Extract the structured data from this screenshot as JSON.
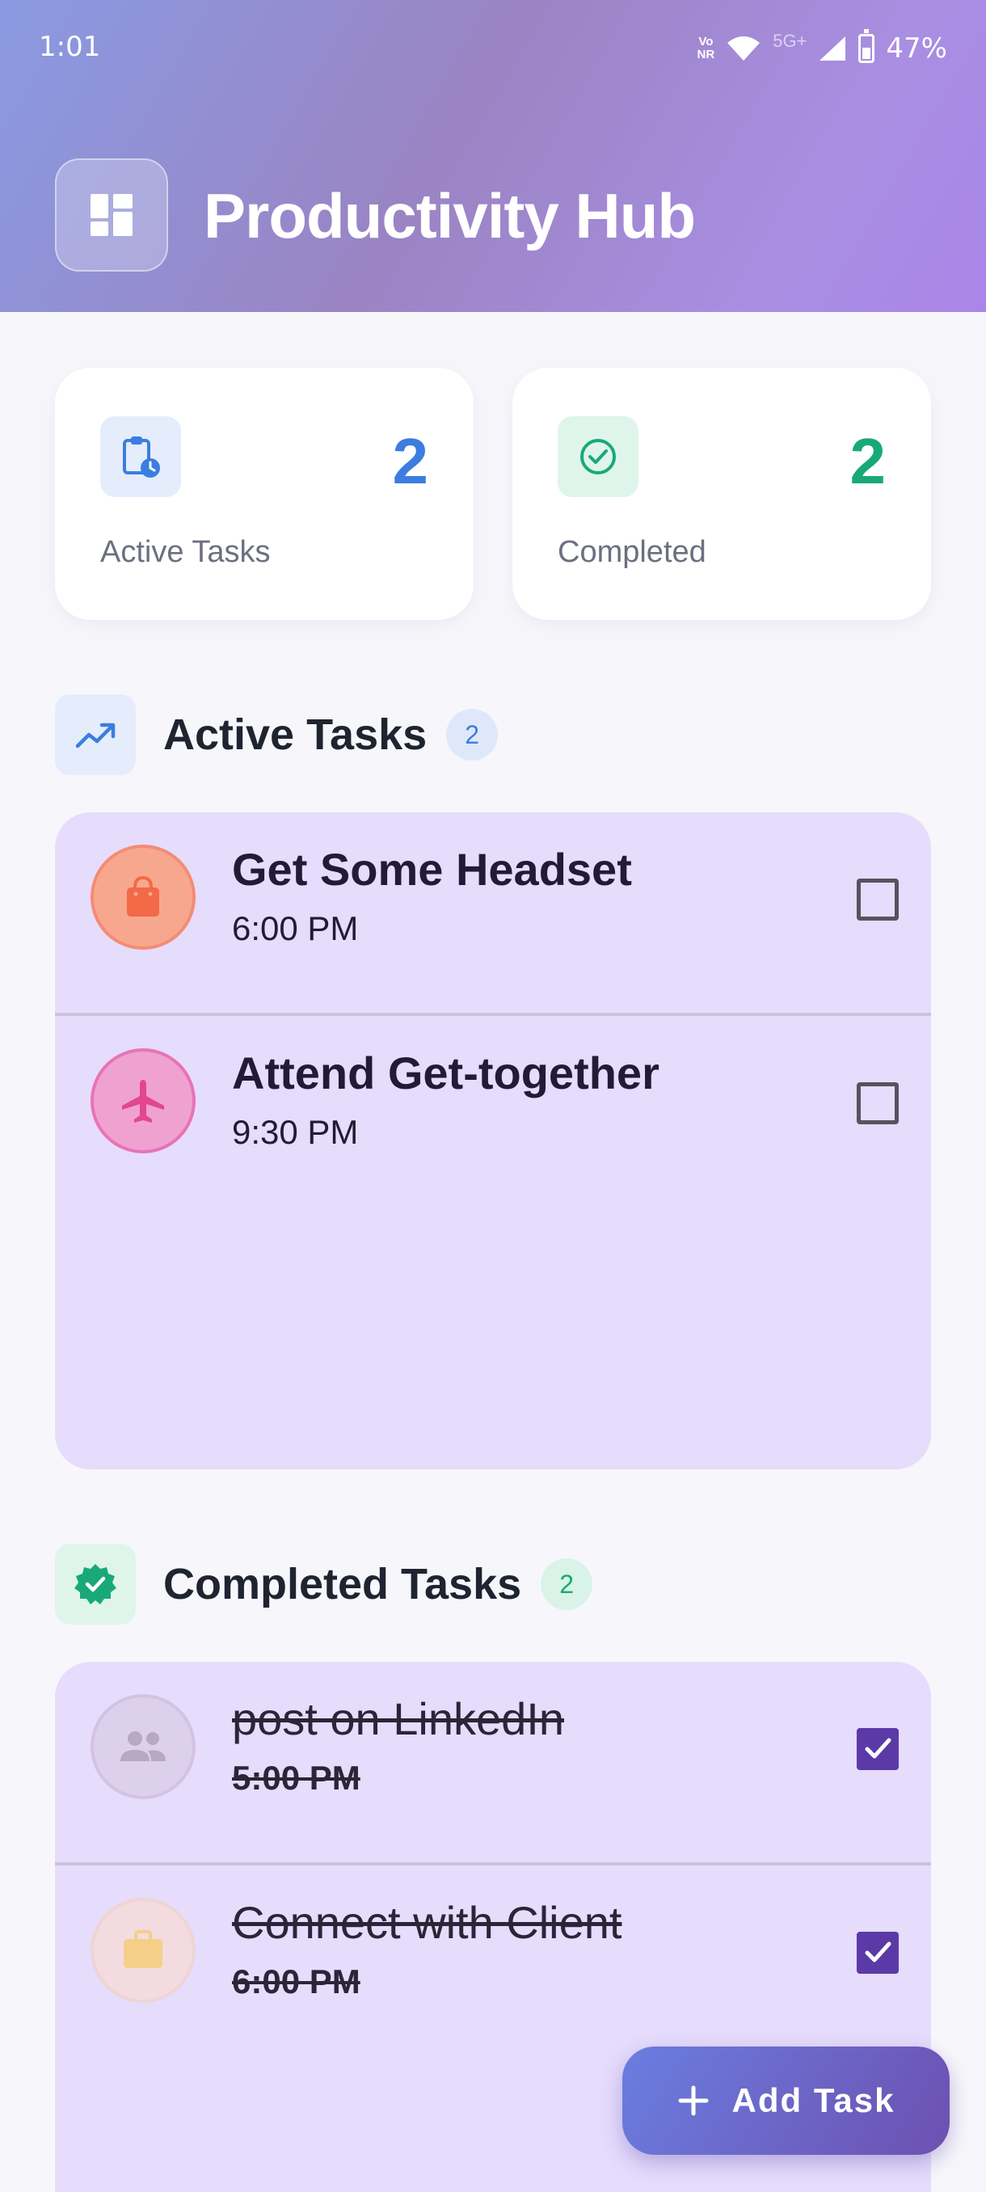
{
  "status_bar": {
    "time": "1:01",
    "volte": "Vo\nNR",
    "network": "5G+",
    "battery": "47%"
  },
  "header": {
    "title": "Productivity Hub"
  },
  "stats": [
    {
      "value": "2",
      "label": "Active Tasks",
      "color": "#3b7de0"
    },
    {
      "value": "2",
      "label": "Completed",
      "color": "#19a978"
    }
  ],
  "active_section": {
    "title": "Active Tasks",
    "count": "2"
  },
  "active_tasks": [
    {
      "title": "Get Some Headset",
      "time": "6:00 PM",
      "icon": "shopping-bag-icon",
      "checked": false
    },
    {
      "title": "Attend Get-together",
      "time": "9:30 PM",
      "icon": "airplane-icon",
      "checked": false
    }
  ],
  "completed_section": {
    "title": "Completed Tasks",
    "count": "2"
  },
  "completed_tasks": [
    {
      "title": "post on LinkedIn",
      "time": "5:00 PM",
      "icon": "people-icon",
      "checked": true
    },
    {
      "title": "Connect with Client",
      "time": "6:00 PM",
      "icon": "briefcase-icon",
      "checked": true
    }
  ],
  "fab": {
    "icon": "plus-icon",
    "label": "Add Task"
  },
  "colors": {
    "header_gradient_start": "#8a9ae2",
    "header_gradient_end": "#a985e8",
    "active_blue": "#3b7de0",
    "complete_green": "#19a978",
    "task_panel": "#e6dcfc",
    "checkbox_checked": "#5b3aa8"
  }
}
